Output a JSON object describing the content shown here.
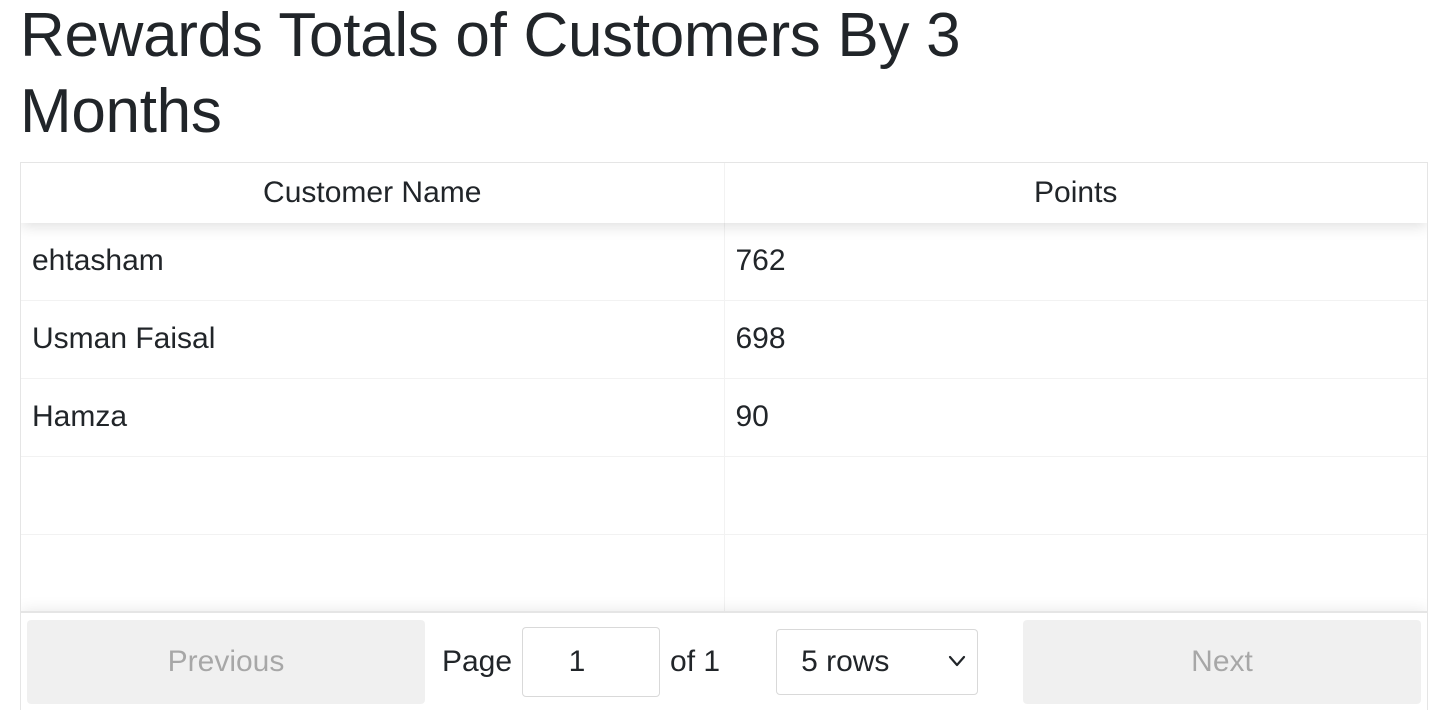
{
  "page": {
    "title": "Rewards Totals of Customers By 3 Months"
  },
  "table": {
    "columns": [
      "Customer Name",
      "Points"
    ],
    "rows": [
      [
        "ehtasham",
        "762"
      ],
      [
        "Usman Faisal",
        "698"
      ],
      [
        "Hamza",
        "90"
      ],
      [
        "",
        ""
      ],
      [
        "",
        ""
      ]
    ]
  },
  "pagination": {
    "previous_label": "Previous",
    "next_label": "Next",
    "page_label": "Page",
    "current_page": "1",
    "of_label": "of 1",
    "page_size_selected": "5 rows"
  },
  "icons": {
    "select_chevron": "chevron-down-icon"
  }
}
